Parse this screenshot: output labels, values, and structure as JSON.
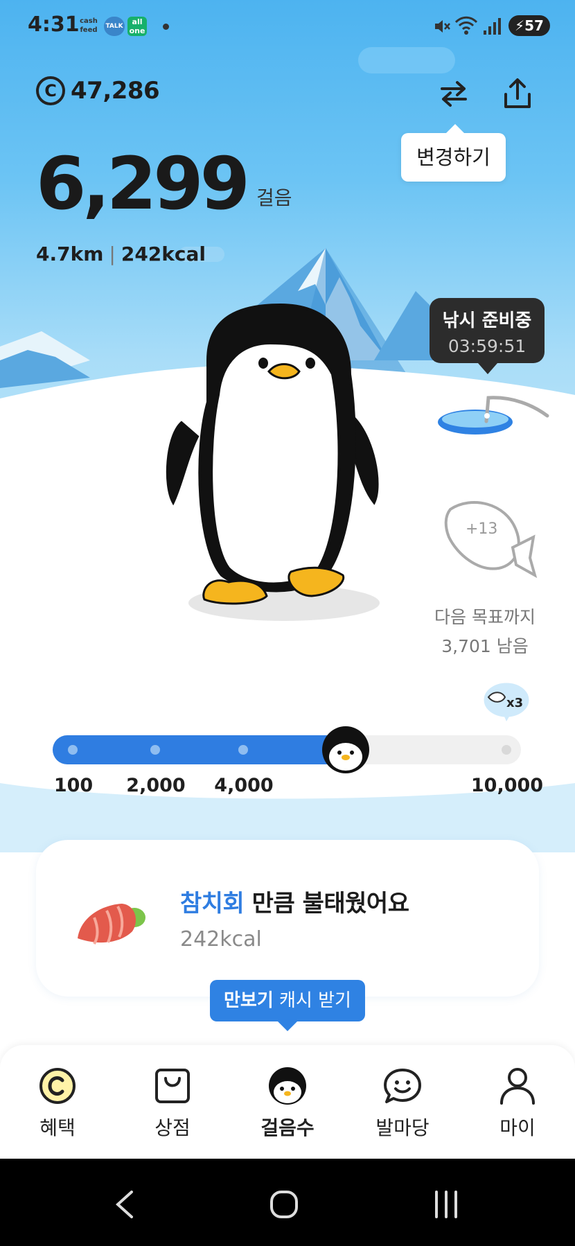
{
  "status_bar": {
    "time": "4:31",
    "app_icons": [
      "cash feed",
      "TALK",
      "all one"
    ],
    "battery_level": "57"
  },
  "header": {
    "coin_symbol": "C",
    "coin_amount": "47,286",
    "change_tooltip": "변경하기"
  },
  "steps": {
    "count": "6,299",
    "unit": "걸음",
    "distance": "4.7km",
    "calories": "242kcal"
  },
  "fishing": {
    "title": "낚시 준비중",
    "timer": "03:59:51",
    "goal_text_1": "다음 목표까지",
    "goal_text_2": "3,701 남음"
  },
  "progress": {
    "current_steps": 6299,
    "max_steps": 10000,
    "milestones": [
      "100",
      "2,000",
      "4,000",
      "10,000"
    ]
  },
  "burn_card": {
    "highlight": "참치회",
    "title_rest": " 만큼 불태웠어요",
    "calories": "242kcal"
  },
  "cash_button": {
    "bold": "만보기",
    "rest": " 캐시 받기"
  },
  "bottom_nav": {
    "items": [
      {
        "label": "혜택",
        "icon": "coin-icon",
        "active": false
      },
      {
        "label": "상점",
        "icon": "shopping-bag-icon",
        "active": false
      },
      {
        "label": "걸음수",
        "icon": "penguin-icon",
        "active": true
      },
      {
        "label": "발마당",
        "icon": "chat-smile-icon",
        "active": false
      },
      {
        "label": "마이",
        "icon": "person-icon",
        "active": false
      }
    ]
  },
  "colors": {
    "accent": "#2f7de1",
    "sky_top": "#4db3f0",
    "foot_yellow": "#f5b51e"
  }
}
